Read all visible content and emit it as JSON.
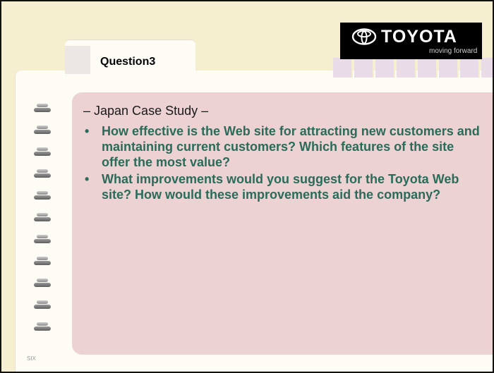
{
  "header": {
    "tab_label": "Question3",
    "logo": {
      "brand": "TOYOTA",
      "tagline": "moving forward",
      "emblem": "toyota-emblem-icon"
    }
  },
  "content": {
    "subtitle": "– Japan Case Study –",
    "bullets": [
      {
        "text": "How effective is the Web site for attracting new customers and maintaining current customers? Which features of the site offer the most value?"
      },
      {
        "text": "What improvements would you suggest for the Toyota Web site? How would these improvements aid the company?"
      }
    ],
    "bullet_symbol": "•"
  },
  "footer": {
    "page_mark": "SIX"
  },
  "colors": {
    "background": "#f6efcf",
    "paper": "#fffcf6",
    "content_panel": "#edd2d4",
    "bullet_text": "#2a6b59",
    "tab_strip": "#eadbe9",
    "logo_background": "#000000"
  }
}
